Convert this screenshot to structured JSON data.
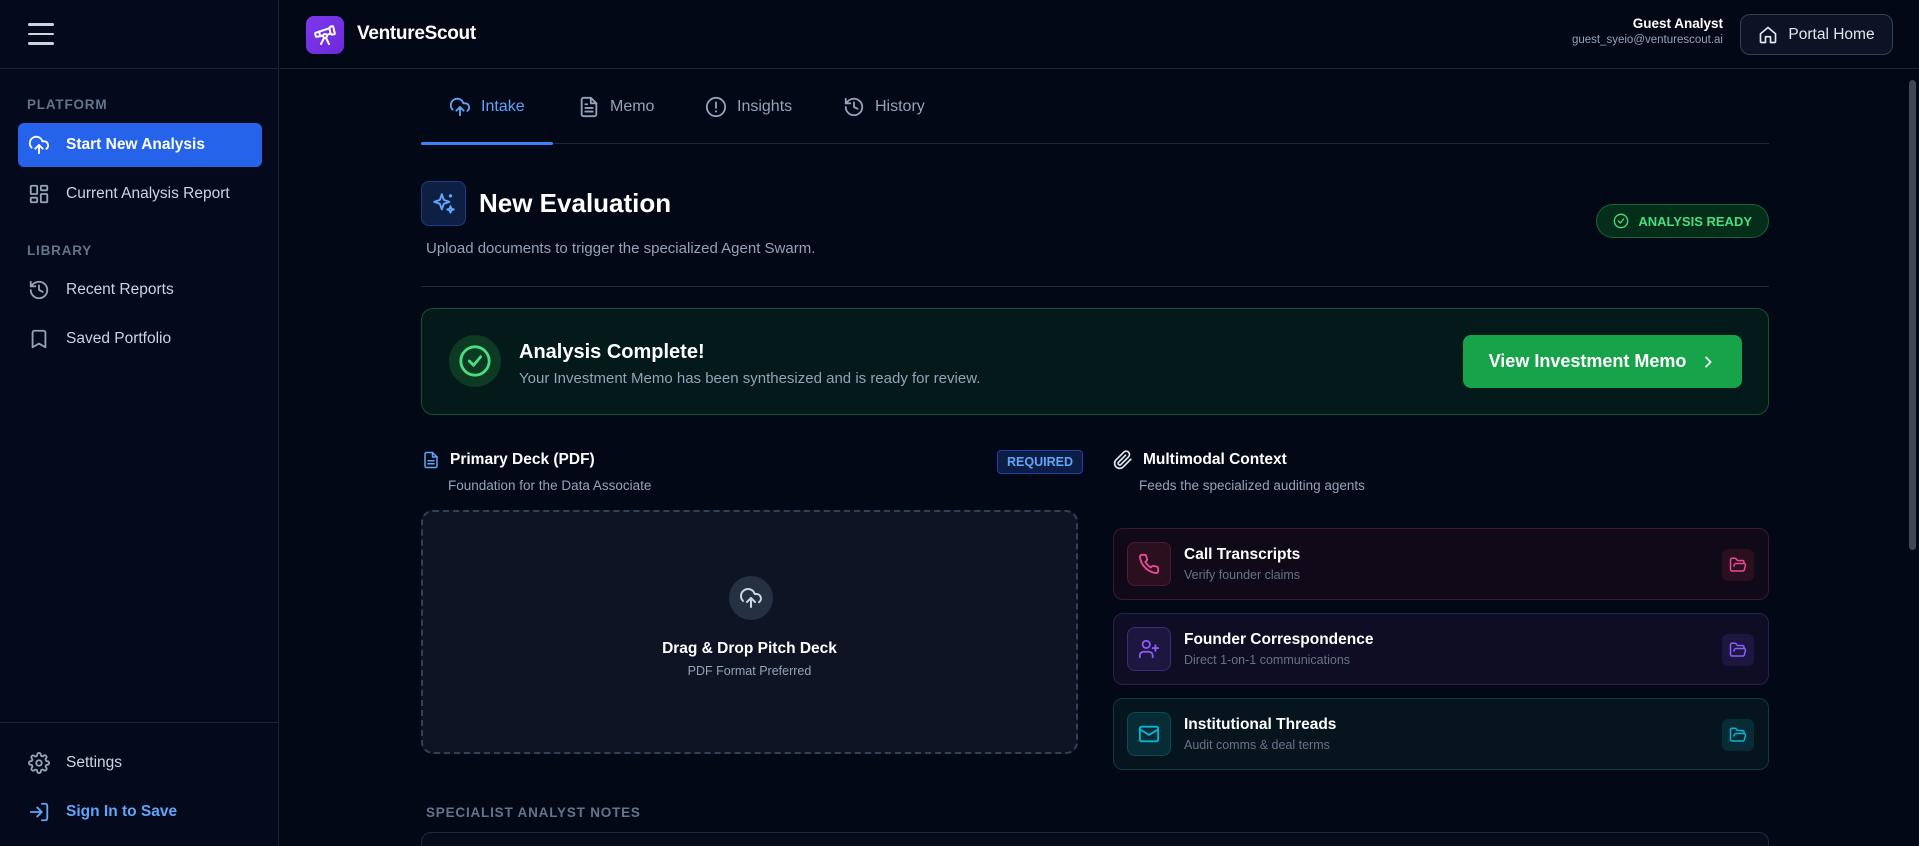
{
  "app": {
    "brand": "VentureScout"
  },
  "sidebar": {
    "sections": {
      "platform": "PLATFORM",
      "library": "LIBRARY"
    },
    "items": [
      {
        "label": "Start New Analysis",
        "icon": "cloud-upload-icon",
        "active": true
      },
      {
        "label": "Current Analysis Report",
        "icon": "grid-icon"
      },
      {
        "label": "Recent Reports",
        "icon": "history-icon"
      },
      {
        "label": "Saved Portfolio",
        "icon": "bookmark-icon"
      }
    ],
    "bottom": {
      "settings": "Settings",
      "sign_in": "Sign In to Save"
    }
  },
  "header": {
    "user_name": "Guest Analyst",
    "user_email": "guest_syeio@venturescout.ai",
    "portal_button": "Portal Home"
  },
  "tabs": [
    {
      "label": "Intake",
      "icon": "cloud-upload-icon",
      "active": true
    },
    {
      "label": "Memo",
      "icon": "document-icon"
    },
    {
      "label": "Insights",
      "icon": "alert-circle-icon"
    },
    {
      "label": "History",
      "icon": "history-icon"
    }
  ],
  "page": {
    "title": "New Evaluation",
    "subtitle": "Upload documents to trigger the specialized Agent Swarm.",
    "status_badge": "ANALYSIS READY"
  },
  "complete_banner": {
    "title": "Analysis Complete!",
    "subtitle": "Your Investment Memo has been synthesized and is ready for review.",
    "button": "View Investment Memo"
  },
  "primary_deck": {
    "title": "Primary Deck (PDF)",
    "subtitle": "Foundation for the Data Associate",
    "badge": "REQUIRED",
    "drop_title": "Drag & Drop Pitch Deck",
    "drop_sub": "PDF Format Preferred"
  },
  "multimodal": {
    "title": "Multimodal Context",
    "subtitle": "Feeds the specialized auditing agents",
    "cards": [
      {
        "title": "Call Transcripts",
        "subtitle": "Verify founder claims",
        "icon": "phone-icon",
        "accent": "#ec4899"
      },
      {
        "title": "Founder Correspondence",
        "subtitle": "Direct 1-on-1 communications",
        "icon": "user-plus-icon",
        "accent": "#8b5cf6"
      },
      {
        "title": "Institutional Threads",
        "subtitle": "Audit comms & deal terms",
        "icon": "mail-icon",
        "accent": "#06b6d4"
      }
    ]
  },
  "notes": {
    "label": "SPECIALIST ANALYST NOTES"
  },
  "colors": {
    "background": "#030817",
    "primary": "#2563eb",
    "success": "#16a34a",
    "brand": "#7c3aed"
  }
}
